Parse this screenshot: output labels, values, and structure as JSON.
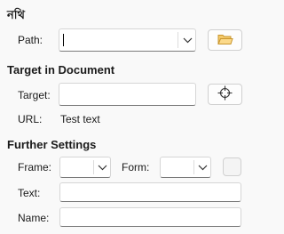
{
  "link": {
    "title": "নথি",
    "path_label": "Path:",
    "path_value": ""
  },
  "target": {
    "title": "Target in Document",
    "target_label": "Target:",
    "url_label": "URL:",
    "url_value": "Test text"
  },
  "further": {
    "title": "Further Settings",
    "frame_label": "Frame:",
    "form_label": "Form:",
    "text_label": "Text:",
    "name_label": "Name:"
  },
  "icons": {
    "folder": "folder-open-icon",
    "target": "crosshair-icon",
    "dropdown": "chevron-down-icon"
  },
  "colors": {
    "folder_fill": "#f4c96a",
    "folder_stroke": "#c9962e"
  }
}
